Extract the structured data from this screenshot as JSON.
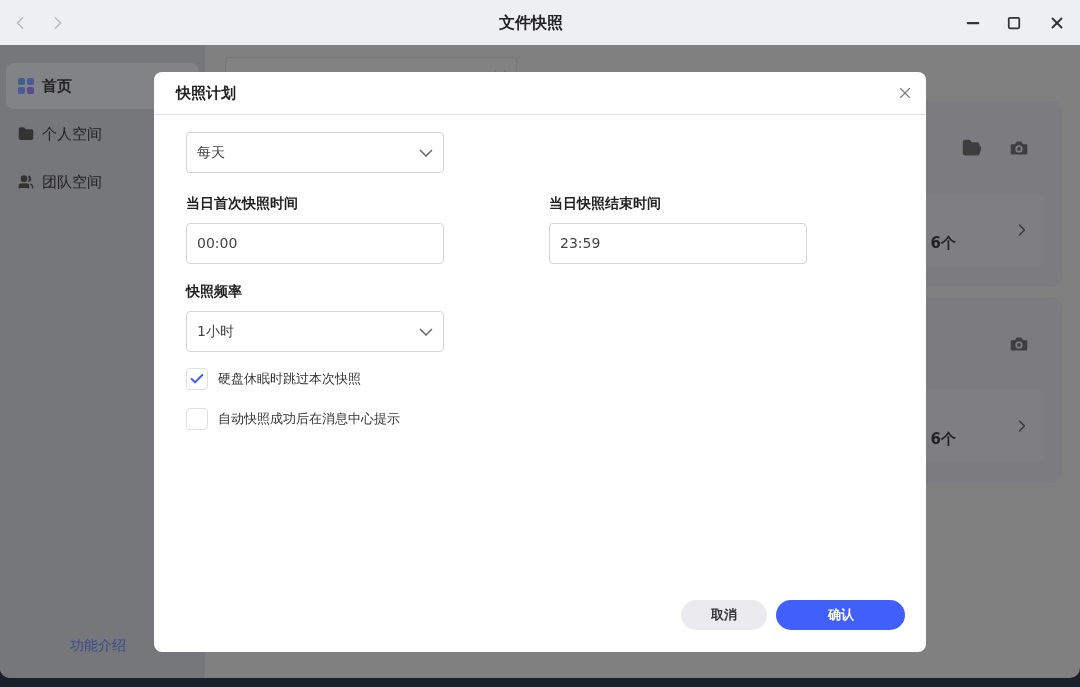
{
  "window": {
    "title": "文件快照"
  },
  "sidebar": {
    "items": [
      {
        "label": "首页",
        "selected": true,
        "kind": "home"
      },
      {
        "label": "个人空间",
        "selected": false,
        "kind": "folder"
      },
      {
        "label": "团队空间",
        "selected": false,
        "kind": "team"
      }
    ],
    "footer_link": "功能介绍"
  },
  "background": {
    "cards": [
      {
        "count": "6个",
        "folder_action": true
      },
      {
        "count": "6个",
        "folder_action": false
      }
    ]
  },
  "dialog": {
    "title": "快照计划",
    "repeat": {
      "value": "每天"
    },
    "start": {
      "label": "当日首次快照时间",
      "value": "00:00"
    },
    "end": {
      "label": "当日快照结束时间",
      "value": "23:59"
    },
    "frequency": {
      "label": "快照频率",
      "value": "1小时"
    },
    "options": [
      {
        "label": "硬盘休眠时跳过本次快照",
        "checked": true
      },
      {
        "label": "自动快照成功后在消息中心提示",
        "checked": false
      }
    ],
    "buttons": [
      {
        "label": "取消",
        "kind": "secondary"
      },
      {
        "label": "确认",
        "kind": "primary"
      }
    ]
  }
}
